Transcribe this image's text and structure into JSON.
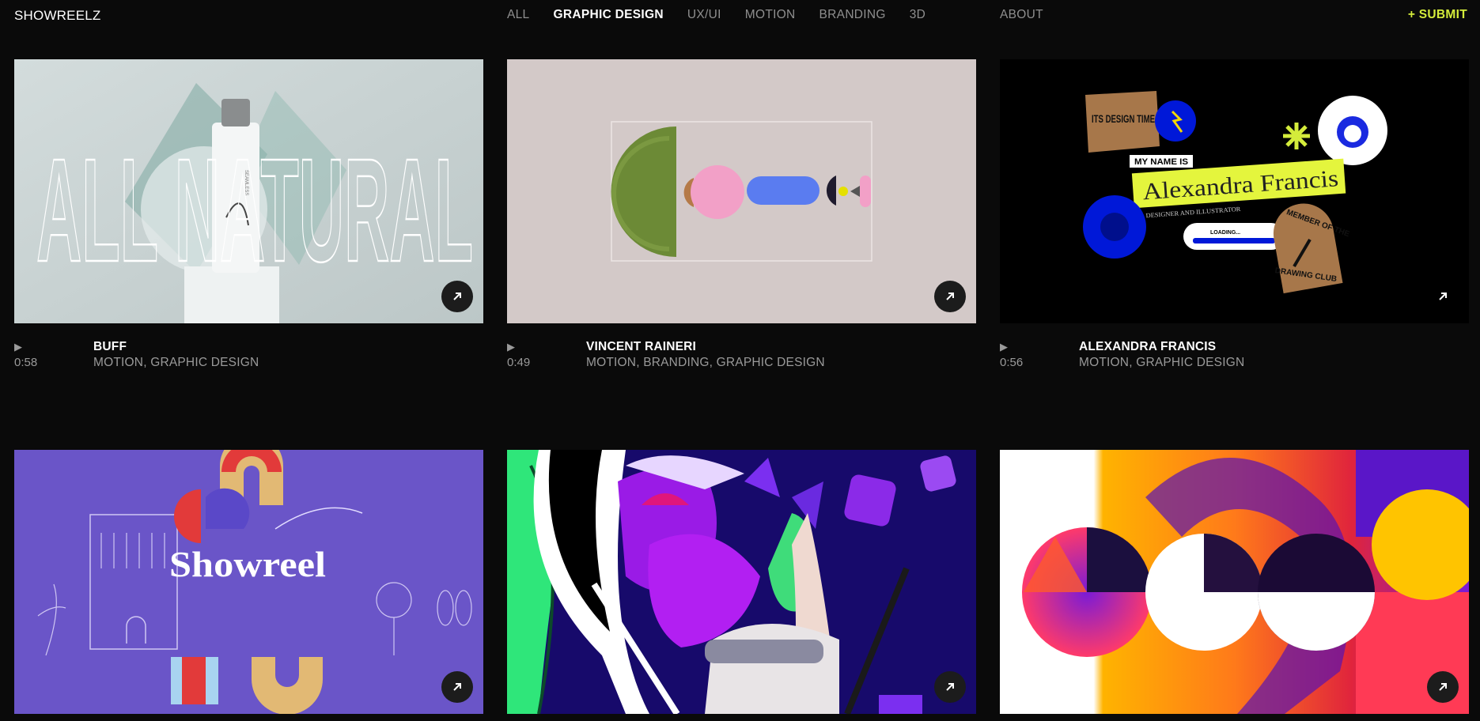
{
  "header": {
    "brand": "SHOWREELZ",
    "nav": [
      "ALL",
      "GRAPHIC DESIGN",
      "UX/UI",
      "MOTION",
      "BRANDING",
      "3D"
    ],
    "active_nav": "GRAPHIC DESIGN",
    "about": "ABOUT",
    "submit": "+ SUBMIT"
  },
  "cards": [
    {
      "title": "BUFF",
      "duration": "0:58",
      "tags": "MOTION, GRAPHIC DESIGN",
      "play_icon": "▶",
      "thumb_text": "ALL NATURAL",
      "bottle_text": "SEAMLESS"
    },
    {
      "title": "VINCENT RAINERI",
      "duration": "0:49",
      "tags": "MOTION, BRANDING, GRAPHIC DESIGN",
      "play_icon": "▶"
    },
    {
      "title": "ALEXANDRA FRANCIS",
      "duration": "0:56",
      "tags": "MOTION, GRAPHIC DESIGN",
      "play_icon": "▶",
      "sticker_top": "ITS DESIGN TIME",
      "name_label": "MY NAME IS",
      "name": "Alexandra Francis",
      "subtitle": "DESIGNER AND ILLUSTRATOR",
      "loading": "LOADING...",
      "badge_line1": "MEMBER OF THE",
      "badge_line2": "DRAWING CLUB"
    },
    {
      "thumb_text": "Showreel"
    },
    {},
    {}
  ],
  "colors": {
    "accent": "#d4ec3b",
    "bg": "#0a0a0a",
    "muted": "#9a9a9a"
  }
}
